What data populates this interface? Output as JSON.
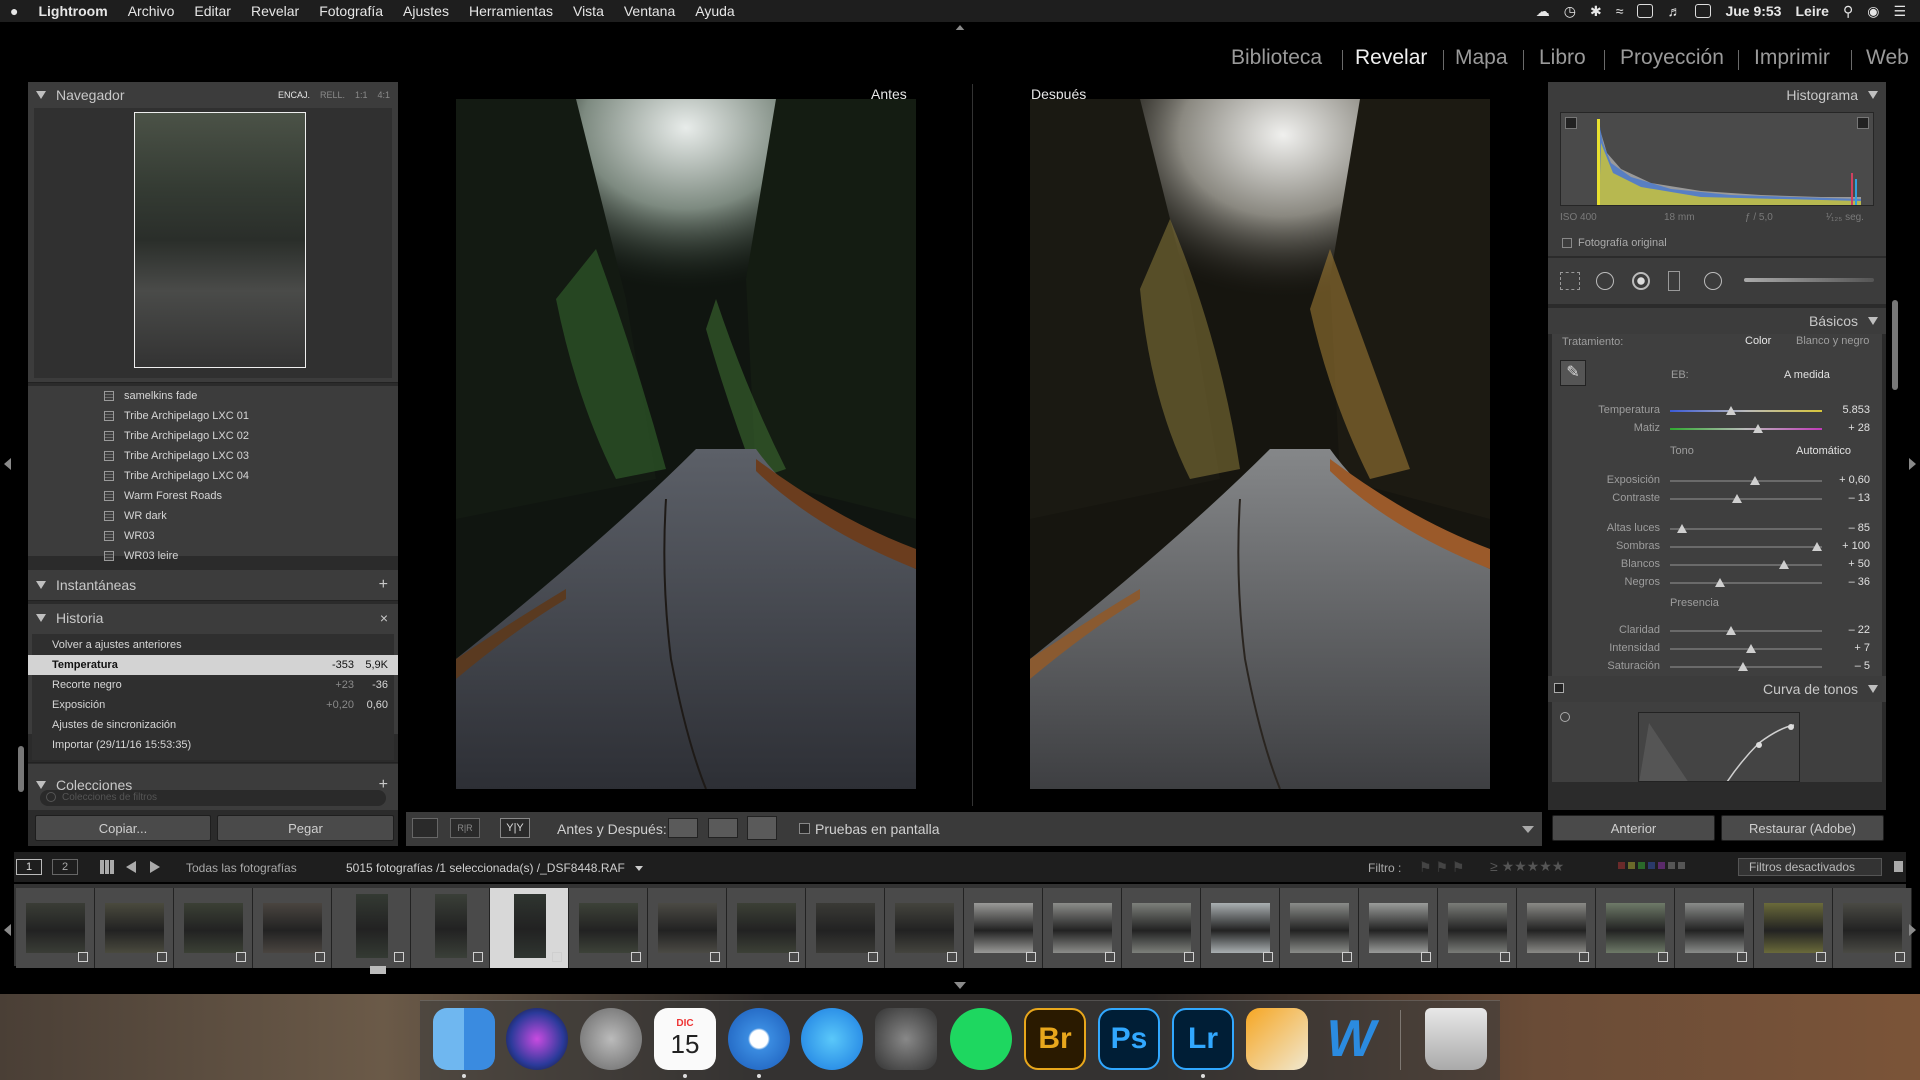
{
  "menubar": {
    "apple": "",
    "app": "Lightroom",
    "items": [
      "Archivo",
      "Editar",
      "Revelar",
      "Fotografía",
      "Ajustes",
      "Herramientas",
      "Vista",
      "Ventana",
      "Ayuda"
    ],
    "clock": "Jue 9:53",
    "user": "Leire"
  },
  "modules": [
    "Biblioteca",
    "Revelar",
    "Mapa",
    "Libro",
    "Proyección",
    "Imprimir",
    "Web"
  ],
  "navigator": {
    "title": "Navegador",
    "zoom": [
      "ENCAJ.",
      "RELL.",
      "1:1",
      "4:1"
    ]
  },
  "presets": [
    "samelkins fade",
    "Tribe Archipelago LXC 01",
    "Tribe Archipelago LXC 02",
    "Tribe Archipelago LXC 03",
    "Tribe Archipelago LXC 04",
    "Warm Forest Roads",
    "WR dark",
    "WR03",
    "WR03 leire"
  ],
  "snapshots": {
    "title": "Instantáneas",
    "action": "+"
  },
  "history": {
    "title": "Historia",
    "action": "×",
    "rows": [
      {
        "name": "Volver a ajustes anteriores",
        "v1": "",
        "v2": ""
      },
      {
        "name": "Temperatura",
        "v1": "-353",
        "v2": "5,9K"
      },
      {
        "name": "Recorte negro",
        "v1": "+23",
        "v2": "-36"
      },
      {
        "name": "Exposición",
        "v1": "+0,20",
        "v2": "0,60"
      },
      {
        "name": "Ajustes de sincronización",
        "v1": "",
        "v2": ""
      },
      {
        "name": "Importar (29/11/16 15:53:35)",
        "v1": "",
        "v2": ""
      }
    ]
  },
  "collections": {
    "title": "Colecciones",
    "action": "+",
    "filter_placeholder": "Colecciones de filtros"
  },
  "left_buttons": {
    "copy": "Copiar...",
    "paste": "Pegar"
  },
  "view": {
    "before": "Antes",
    "after": "Después"
  },
  "toolbar": {
    "before_after": "Antes y Después:",
    "proof": "Pruebas en pantalla"
  },
  "histogram": {
    "title": "Histograma",
    "iso": "ISO 400",
    "focal": "18 mm",
    "aperture": "ƒ / 5,0",
    "shutter": "¹⁄₁₂₅ seg.",
    "original": "Fotografía original"
  },
  "basics": {
    "title": "Básicos",
    "treatment_label": "Tratamiento:",
    "treatment_color": "Color",
    "treatment_bw": "Blanco y negro",
    "wb_label": "EB:",
    "wb_value": "A medida",
    "tone_label": "Tono",
    "auto": "Automático",
    "presence_label": "Presencia",
    "sliders": [
      {
        "name": "Temperatura",
        "value": "5.853",
        "pos": 0.4
      },
      {
        "name": "Matiz",
        "value": "+ 28",
        "pos": 0.58
      },
      {
        "name": "Exposición",
        "value": "+ 0,60",
        "pos": 0.56
      },
      {
        "name": "Contraste",
        "value": "– 13",
        "pos": 0.44
      },
      {
        "name": "Altas luces",
        "value": "– 85",
        "pos": 0.08
      },
      {
        "name": "Sombras",
        "value": "+ 100",
        "pos": 0.97
      },
      {
        "name": "Blancos",
        "value": "+ 50",
        "pos": 0.75
      },
      {
        "name": "Negros",
        "value": "– 36",
        "pos": 0.33
      },
      {
        "name": "Claridad",
        "value": "– 22",
        "pos": 0.4
      },
      {
        "name": "Intensidad",
        "value": "+ 7",
        "pos": 0.53
      },
      {
        "name": "Saturación",
        "value": "– 5",
        "pos": 0.48
      }
    ]
  },
  "tone_curve": {
    "title": "Curva de tonos"
  },
  "right_buttons": {
    "previous": "Anterior",
    "reset": "Restaurar (Adobe)"
  },
  "filmbar": {
    "screen1": "1",
    "screen2": "2",
    "source": "Todas las fotografías",
    "count": "5015 fotografías /1 seleccionada(s) /_DSF8448.RAF",
    "filter_label": "Filtro :",
    "filter_state": "Filtros desactivados"
  },
  "dock": [
    {
      "name": "finder-icon",
      "label": ""
    },
    {
      "name": "siri-icon",
      "label": ""
    },
    {
      "name": "launchpad-icon",
      "label": ""
    },
    {
      "name": "calendar-icon",
      "label": "15",
      "month": "DIC"
    },
    {
      "name": "safari-icon",
      "label": ""
    },
    {
      "name": "app-store-icon",
      "label": ""
    },
    {
      "name": "system-preferences-icon",
      "label": ""
    },
    {
      "name": "spotify-icon",
      "label": ""
    },
    {
      "name": "bridge-icon",
      "label": "Br"
    },
    {
      "name": "photoshop-icon",
      "label": "Ps"
    },
    {
      "name": "lightroom-icon",
      "label": "Lr"
    },
    {
      "name": "pages-icon",
      "label": ""
    },
    {
      "name": "word-icon",
      "label": "W"
    },
    {
      "name": "trash-icon",
      "label": ""
    }
  ]
}
